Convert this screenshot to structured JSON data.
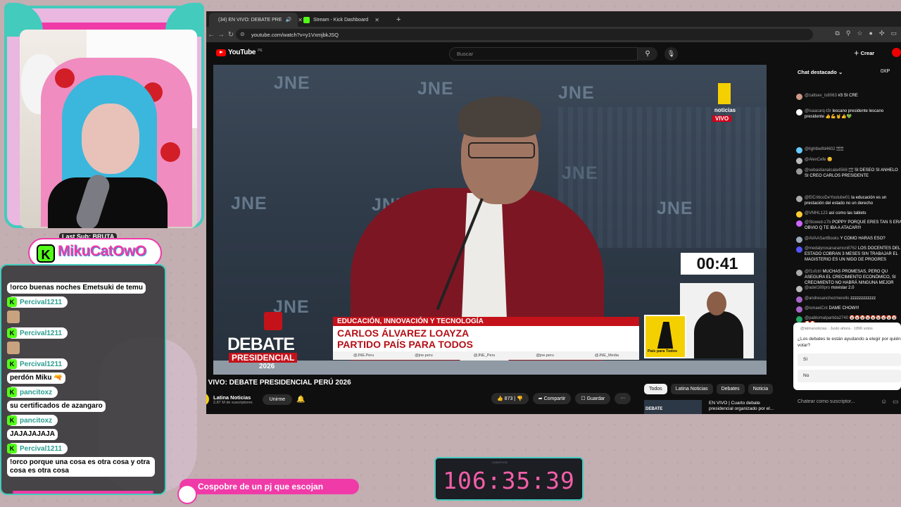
{
  "browser": {
    "tabs": [
      {
        "label": "(34) EN VIVO: DEBATE PRE",
        "active": true,
        "icon": "youtube-favicon"
      },
      {
        "label": "Stream - Kick Dashboard",
        "active": false,
        "icon": "kick-favicon"
      }
    ],
    "new_tab": "+",
    "url": "youtube.com/watch?v=y1VxmjbkJSQ"
  },
  "youtube": {
    "logo": "YouTube",
    "logo_suffix": "PE",
    "search_placeholder": "Buscar",
    "create_label": "Crear",
    "video": {
      "watermarks": [
        "JNE",
        "JNE",
        "JNE",
        "JNE",
        "JNE",
        "JNE",
        "JNE",
        "JNE"
      ],
      "topic": "EDUCACIÓN, INNOVACIÓN Y TECNOLOGÍA",
      "candidate_name": "CARLOS ÁLVAREZ LOAYZA",
      "party": "PARTIDO PAÍS PARA TODOS",
      "socials": [
        "@JNE.Peru",
        "@jne.peru",
        "@JNE_Peru",
        "@jne.peru",
        "@JNE_Media"
      ],
      "debate_word": "DEBATE",
      "debate_sub": "PRESIDENCIAL",
      "debate_year": "2026",
      "timer": "00:41",
      "party_logo_text": "País para Todos",
      "channel_bug": "noticias",
      "live_badge": "VIVO"
    },
    "title": "EN VIVO: DEBATE PRESIDENCIAL PERÚ 2026",
    "channel": {
      "name": "Latina Noticias",
      "subs": "2,87 M de suscriptores",
      "join": "Unirme"
    },
    "actions": {
      "likes": "873",
      "share": "Compartir",
      "save": "Guardar",
      "more": "···"
    },
    "chips": [
      "Todos",
      "Latina Noticias",
      "Debates",
      "Noticia"
    ],
    "recommended": {
      "thumb": "DEBATE",
      "title": "EN VIVO | Cuarto debate presidencial organizado por el..."
    }
  },
  "livechat": {
    "header": "Chat destacado",
    "xp": "0XP",
    "messages": [
      {
        "user": "@zaltsev_ls8063",
        "text": "#3 SI CRE",
        "color": "#c98"
      },
      {
        "user": "@isaacarq-t3r",
        "text": "lescano presidente lescano presidente 👍💪🤘👍💚",
        "color": "#fff"
      },
      {
        "user": "@lightbelfd4602",
        "text": "🕯🕯🕯🕯🕯🕯",
        "color": "#6cf"
      },
      {
        "user": "@AlexCefe",
        "text": "😊",
        "color": "#bbb"
      },
      {
        "user": "@sebastianalcala4568",
        "text": "🕯🕯🕯🕯 SI DESEO SI ANHELO SI CREO CARLOS PRESIDENTE",
        "color": "#999"
      },
      {
        "user": "@ElCriticoDeYoutube01",
        "text": "la educación es un prestación del estado no un derecho",
        "color": "#aaa"
      },
      {
        "user": "@VMHL123",
        "text": "así como las tablets",
        "color": "#fc3"
      },
      {
        "user": "@Slowed-z7b",
        "text": "POPPY PORQUE ERES TAN S ERA OBVIO Q TE IBA A ATACAR!!!",
        "color": "#c6f"
      },
      {
        "user": "@AVAASartBooks",
        "text": "Y COMO HARAS ESO?",
        "color": "#9ab"
      },
      {
        "user": "@medalyroxanaramon8762",
        "text": "LOS DOCENTES DEL ESTADO COBRAN 3 MESES SIN TRABAJAR EL MAGISTERIO ES UN NIDO DE PROGRES",
        "color": "#55f"
      },
      {
        "user": "@f1sfctrl",
        "text": "MUCHAS PROMESAS, PERO QU ASEGURA EL CRECIMIENTO ECONÓMICO, SI CRECIMIENTO NO HABRÁ NINGUNA MEJOR",
        "color": "#aaa"
      },
      {
        "user": "@adel169pro",
        "text": "movistar 2.0",
        "color": "#bbb"
      },
      {
        "user": "@andresanchezmerello",
        "text": "zzzzzzzzzzzz",
        "color": "#a6c"
      },
      {
        "user": "@ismaelCnt",
        "text": "DAME CHOW!!!",
        "color": "#a6c"
      },
      {
        "user": "@pablomalpartida2740",
        "text": "🤡🤡🤡🤡🤡🤡🤡🤡🤡🤡🤡",
        "color": "#2a6"
      }
    ],
    "poll": {
      "source": "@latinanoticias · Justo ahora · 1896 votos",
      "question": "¿Los debates te están ayudando a elegir por quién votar?",
      "options": [
        "Sí",
        "No"
      ]
    },
    "input_placeholder": "Chatear como suscriptor..."
  },
  "overlay": {
    "last_sub": "Last Sub: BRUTA",
    "streamer": "MikuCatOwO",
    "chat": [
      {
        "type": "text",
        "text": "!orco buenas noches Emetsuki de temu"
      },
      {
        "type": "user",
        "user": "Percival1211"
      },
      {
        "type": "emote"
      },
      {
        "type": "user",
        "user": "Percival1211"
      },
      {
        "type": "emote"
      },
      {
        "type": "user",
        "user": "Percival1211"
      },
      {
        "type": "text",
        "text": "perdón Miku 🔫"
      },
      {
        "type": "user",
        "user": "pancitoxz"
      },
      {
        "type": "text",
        "text": "su certificados de azangaro"
      },
      {
        "type": "user",
        "user": "pancitoxz"
      },
      {
        "type": "text",
        "text": "JAJAJAJAJA"
      },
      {
        "type": "user",
        "user": "Percival1211"
      },
      {
        "type": "text",
        "text": "!orco porque una cosa es otra cosa y otra cosa es otra cosa"
      }
    ],
    "ticker": "Cospobre de un pj que escojan",
    "counter_label": "SUBATHON",
    "counter": "106:35:39"
  },
  "colors": {
    "accent_pink": "#f03aa8",
    "accent_teal": "#43cbbd",
    "kick_green": "#53fc18",
    "debate_red": "#c4121a"
  }
}
